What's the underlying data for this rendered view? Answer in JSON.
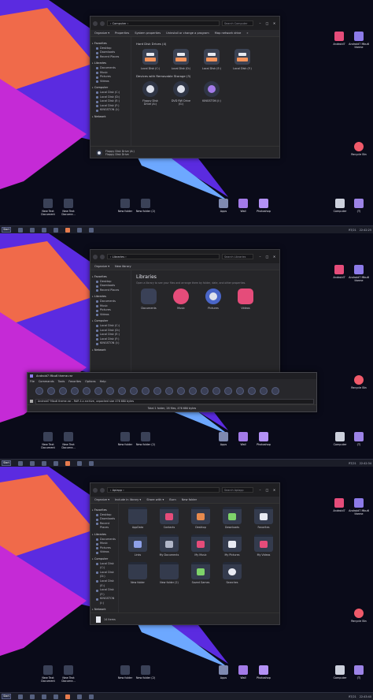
{
  "colors": {
    "accent": "#f4935b",
    "desktop_bg": "#0a0b19",
    "window_bg": "#262629",
    "taskbar_bg": "#1b1d28"
  },
  "desktop": {
    "bottom_icons": [
      {
        "label": "New Text Document",
        "icon": "text-file-icon"
      },
      {
        "label": "New Text Docume...",
        "icon": "text-file-icon"
      },
      {
        "label": "New folder",
        "icon": "folder-icon"
      },
      {
        "label": "New folder (2)",
        "icon": "folder-icon"
      },
      {
        "label": "Apps",
        "icon": "folder-icon"
      },
      {
        "label": "Wall",
        "icon": "folder-icon"
      },
      {
        "label": "Photoshop",
        "icon": "folder-icon"
      },
      {
        "label": "Computer",
        "icon": "computer-icon"
      },
      {
        "label": "(T)",
        "icon": "folder-icon"
      }
    ],
    "right_icons": [
      {
        "label": "Android7",
        "icon": "android-icon"
      },
      {
        "label": "Android7 Mbu6 theme",
        "icon": "theme-icon"
      },
      {
        "label": "Recycle Bin",
        "icon": "recycle-bin-icon"
      }
    ]
  },
  "taskbar": {
    "start_label": "Start",
    "tray_lang": "RT/21",
    "time_1": "22:42:25",
    "time_2": "22:42:34",
    "time_3": "22:43:40"
  },
  "window1": {
    "address": "› Computer ›",
    "search": "Search Computer",
    "toolbar": [
      "Organize ▾",
      "Properties",
      "System properties",
      "Uninstall or change a program",
      "Map network drive",
      "»"
    ],
    "sidebar": {
      "favorites": "Favorites",
      "favorites_items": [
        "Desktop",
        "Downloads",
        "Recent Places"
      ],
      "libraries": "Libraries",
      "libraries_items": [
        "Documents",
        "Music",
        "Pictures",
        "Videos"
      ],
      "computer": "Computer",
      "computer_items": [
        "Local Disk (C:)",
        "Local Disk (D:)",
        "Local Disk (E:)",
        "Local Disk (F:)",
        "KINGSTON (I:)"
      ],
      "network": "Network"
    },
    "hdd_title": "Hard Disk Drives (4)",
    "drives": [
      "Local Disk (C:)",
      "Local Disk (D:)",
      "Local Disk (E:)",
      "Local Disk (F:)"
    ],
    "removable_title": "Devices with Removable Storage (3)",
    "removable": [
      "Floppy Disk Drive (A:)",
      "DVD RW Drive (G:)",
      "KINGSTON (I:)"
    ],
    "status_line1": "Floppy Disk Drive (A:)",
    "status_line2": "Floppy Disk Drive"
  },
  "window2": {
    "address": "› Libraries ›",
    "search": "Search Libraries",
    "toolbar": [
      "Organize ▾",
      "New library"
    ],
    "title": "Libraries",
    "subtitle": "Open a library to see your files and arrange them by folder, date, and other properties.",
    "libraries": [
      "Documents",
      "Music",
      "Pictures",
      "Videos"
    ]
  },
  "archiver": {
    "title": "Android7 Mbu6 theme.rar",
    "menu": [
      "File",
      "Commands",
      "Tools",
      "Favorites",
      "Options",
      "Help"
    ],
    "path": "Android7 Mbu6 theme.rar - RAR 4.x archive, unpacked size 476 680 bytes",
    "status": "Total 1 folder, 28 files, 476 680 bytes"
  },
  "window3": {
    "address": "› Aplapp ›",
    "search": "Search Aplapp",
    "toolbar": [
      "Organize ▾",
      "Include in library ▾",
      "Share with ▾",
      "Burn",
      "New folder"
    ],
    "folders": [
      "AppData",
      "Contacts",
      "Desktop",
      "Downloads",
      "Favorites",
      "Links",
      "My Documents",
      "My Music",
      "My Pictures",
      "My Videos",
      "New folder",
      "New folder (2)",
      "Saved Games",
      "Searches"
    ],
    "status": "14 items"
  }
}
